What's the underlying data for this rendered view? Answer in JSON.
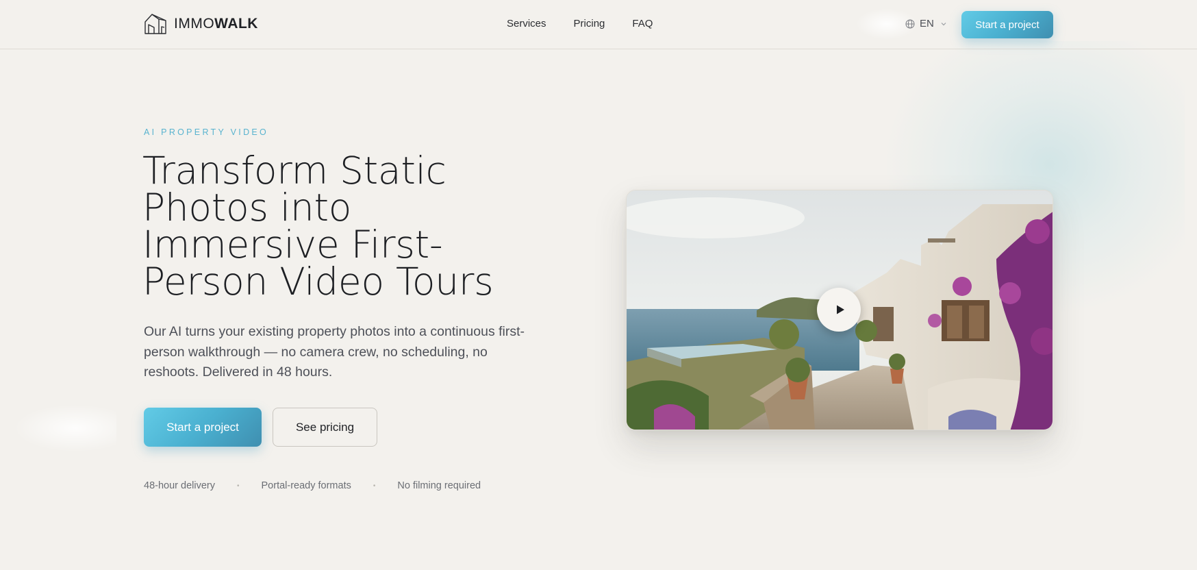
{
  "brand": {
    "name_light": "IMMO",
    "name_bold": "WALK",
    "logo_icon": "house-outline-icon"
  },
  "nav": {
    "items": [
      {
        "label": "Services"
      },
      {
        "label": "Pricing"
      },
      {
        "label": "FAQ"
      }
    ],
    "language": "EN",
    "cta_label": "Start a project"
  },
  "hero": {
    "eyebrow": "AI PROPERTY VIDEO",
    "title": "Transform Static Photos into Immersive First-Person Video Tours",
    "lead": "Our AI turns your existing property photos into a continuous first-person walkthrough — no camera crew, no scheduling, no reshoots. Delivered in 48 hours.",
    "primary_cta": "Start a project",
    "secondary_cta": "See pricing",
    "features": [
      "48-hour delivery",
      "Portal-ready formats",
      "No filming required"
    ]
  },
  "media": {
    "description_icon": "play-icon"
  },
  "colors": {
    "background": "#f3f1ed",
    "accent": "#58b3cf",
    "accent_gradient_start": "#62cbe6",
    "accent_gradient_end": "#3f8fb0",
    "text": "#1f2125"
  }
}
